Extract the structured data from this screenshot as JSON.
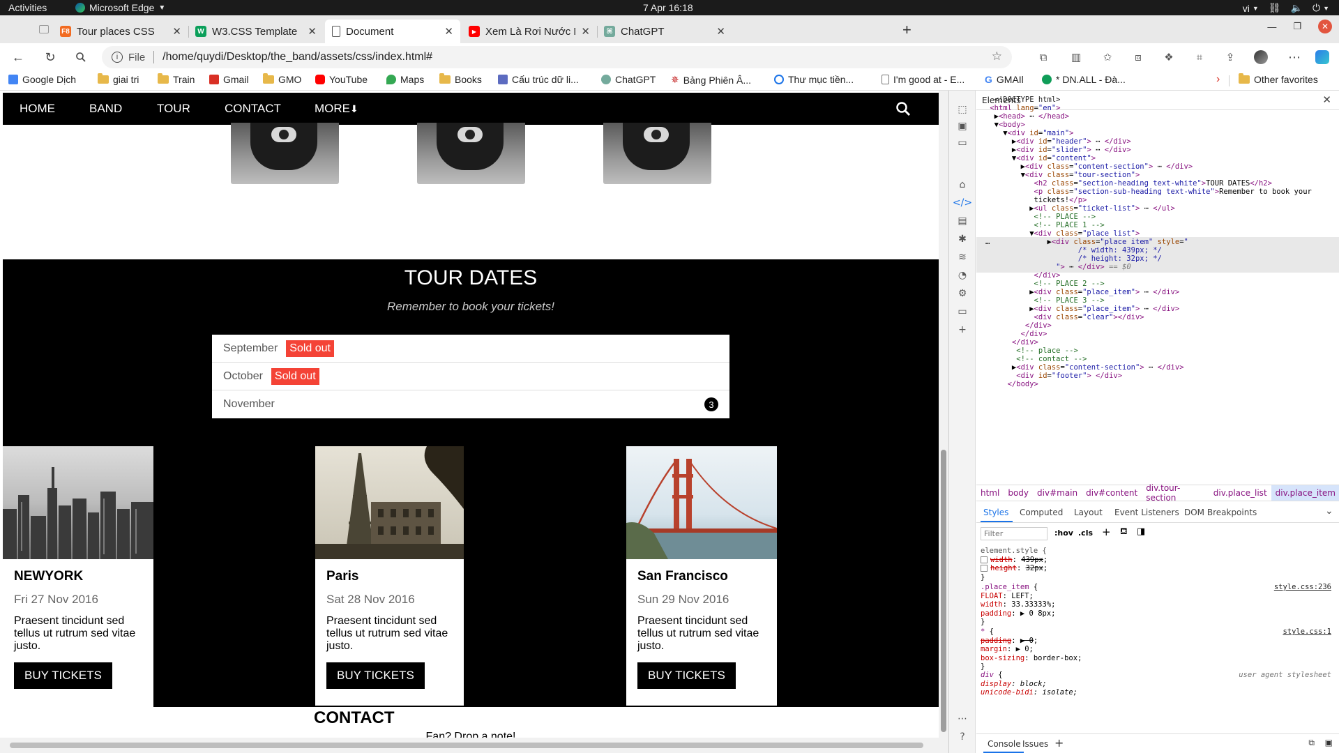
{
  "system": {
    "activities": "Activities",
    "app_name": "Microsoft Edge",
    "clock": "7 Apr  16:18",
    "lang": "vi"
  },
  "tabs": [
    {
      "title": "Tour places CSS",
      "icon_color": "#f26b21",
      "icon_text": "F8"
    },
    {
      "title": "W3.CSS Template",
      "icon_color": "#0b9f5a",
      "icon_text": "W"
    },
    {
      "title": "Document",
      "icon_color": "#ffffff",
      "icon_text": ""
    },
    {
      "title": "Xem Là Rơi Nước Mắt | Th",
      "icon_color": "#ff0000",
      "icon_text": "▶"
    },
    {
      "title": "ChatGPT",
      "icon_color": "#74aa9c",
      "icon_text": "⌘"
    }
  ],
  "address": {
    "scheme_label": "File",
    "url": "/home/quydi/Desktop/the_band/assets/css/index.html#"
  },
  "favorites": [
    {
      "label": "Google Dịch",
      "icon": "google-translate-icon",
      "color": "#4285f4"
    },
    {
      "label": "giai tri",
      "icon": "folder-icon",
      "color": "#e7b84a"
    },
    {
      "label": "Train",
      "icon": "folder-icon",
      "color": "#e7b84a"
    },
    {
      "label": "Gmail",
      "icon": "gmail-icon",
      "color": "#d93025"
    },
    {
      "label": "GMO",
      "icon": "folder-icon",
      "color": "#e7b84a"
    },
    {
      "label": "YouTube",
      "icon": "youtube-icon",
      "color": "#ff0000"
    },
    {
      "label": "Maps",
      "icon": "maps-icon",
      "color": "#34a853"
    },
    {
      "label": "Books",
      "icon": "folder-icon",
      "color": "#e7b84a"
    },
    {
      "label": "Cấu trúc dữ li...",
      "icon": "doc-icon",
      "color": "#5c6bc0"
    },
    {
      "label": "ChatGPT",
      "icon": "chatgpt-icon",
      "color": "#74aa9c"
    },
    {
      "label": "Bảng Phiên Â...",
      "icon": "star-icon",
      "color": "#c62828"
    },
    {
      "label": "Thư mục tiền...",
      "icon": "search-circle-icon",
      "color": "#1a73e8"
    },
    {
      "label": "I'm good at - E...",
      "icon": "page-icon",
      "color": "#777777"
    },
    {
      "label": "GMAIl",
      "icon": "google-icon",
      "color": "#4285f4"
    },
    {
      "label": "* DN.ALL - Đà...",
      "icon": "sheets-icon",
      "color": "#0f9d58"
    }
  ],
  "other_favorites": "Other favorites",
  "page": {
    "nav": [
      "HOME",
      "BAND",
      "TOUR",
      "CONTACT",
      "MORE"
    ],
    "tour_heading": "TOUR DATES",
    "tour_sub": "Remember to book your tickets!",
    "ticket_list": [
      {
        "month": "September",
        "status": "Sold out"
      },
      {
        "month": "October",
        "status": "Sold out"
      },
      {
        "month": "November",
        "badge": "3"
      }
    ],
    "places": [
      {
        "city": "NEWYORK",
        "date": "Fri 27 Nov 2016",
        "text": "Praesent tincidunt sed tellus ut rutrum sed vitae justo.",
        "button": "BUY TICKETS"
      },
      {
        "city": "Paris",
        "date": "Sat 28 Nov 2016",
        "text": "Praesent tincidunt sed tellus ut rutrum sed vitae justo.",
        "button": "BUY TICKETS"
      },
      {
        "city": "San Francisco",
        "date": "Sun 29 Nov 2016",
        "text": "Praesent tincidunt sed tellus ut rutrum sed vitae justo.",
        "button": "BUY TICKETS"
      }
    ],
    "contact_heading": "CONTACT",
    "contact_note": "Fan? Drop a note!"
  },
  "devtools": {
    "panel_title": "Elements",
    "breadcrumbs": [
      "html",
      "body",
      "div#main",
      "div#content",
      "div.tour-section",
      "div.place_list",
      "div.place_item"
    ],
    "style_tabs": [
      "Styles",
      "Computed",
      "Layout",
      "Event Listeners",
      "DOM Breakpoints"
    ],
    "filter_placeholder": "Filter",
    "hov": ":hov",
    "cls": ".cls",
    "console_tabs": [
      "Console",
      "Issues"
    ],
    "src_style236": "style.css:236",
    "src_style1": "style.css:1",
    "src_ua": "user agent stylesheet"
  }
}
